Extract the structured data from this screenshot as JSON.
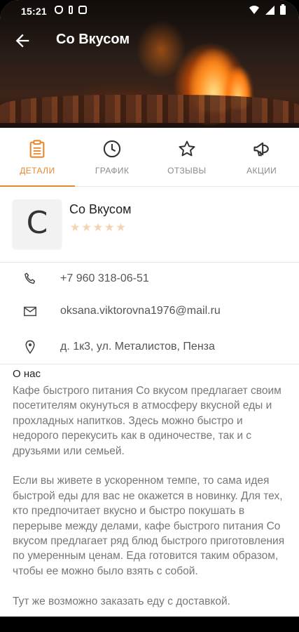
{
  "status_bar": {
    "time": "15:21"
  },
  "app_bar": {
    "title": "Со Вкусом"
  },
  "tabs": [
    {
      "label": "ДЕТАЛИ",
      "icon": "clipboard-icon",
      "active": true
    },
    {
      "label": "ГРАФИК",
      "icon": "clock-icon",
      "active": false
    },
    {
      "label": "ОТЗЫВЫ",
      "icon": "star-outline-icon",
      "active": false
    },
    {
      "label": "АКЦИИ",
      "icon": "megaphone-icon",
      "active": false
    }
  ],
  "profile": {
    "avatar_letter": "С",
    "name": "Со Вкусом",
    "rating_stars": 5,
    "rating_filled": 0
  },
  "contacts": [
    {
      "icon": "phone-icon",
      "text": "+7 960 318-06-51"
    },
    {
      "icon": "email-icon",
      "text": "oksana.viktorovna1976@mail.ru"
    },
    {
      "icon": "location-icon",
      "text": "д. 1к3, ул. Металистов, Пенза"
    }
  ],
  "about": {
    "title": "О нас",
    "text": "Кафе быстрого питания Со вкусом предлагает своим посетителям окунуться в атмосферу вкусной еды и прохладных напитков. Здесь можно быстро и недорого перекусить как в одиночестве, так и с друзьями или семьей.\n\nЕсли вы живете в ускоренном темпе, то сама идея быстрой еды для вас не окажется в новинку. Для тех, кто предпочитает вкусно и быстро покушать в перерыве между делами, кафе быстрого питания Со вкусом предлагает ряд блюд быстрого приготовления по умеренным ценам. Еда готовится таким образом, чтобы ее можно было взять с собой.\n\nТут же возможно заказать еду с доставкой."
  },
  "colors": {
    "accent": "#e8892c",
    "star_inactive": "#f6d2b1"
  }
}
